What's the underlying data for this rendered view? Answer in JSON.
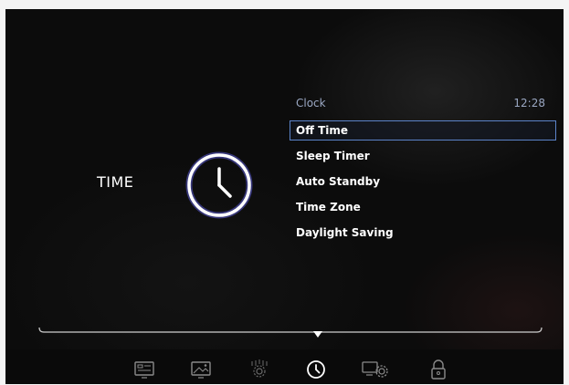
{
  "section": {
    "title": "TIME"
  },
  "menu": {
    "header_title": "Clock",
    "header_time": "12:28",
    "items": [
      {
        "label": "Off Time",
        "selected": true
      },
      {
        "label": "Sleep Timer",
        "selected": false
      },
      {
        "label": "Auto Standby",
        "selected": false
      },
      {
        "label": "Time Zone",
        "selected": false
      },
      {
        "label": "Daylight Saving",
        "selected": false
      }
    ]
  },
  "nav": {
    "active": "time-icon",
    "icons": [
      "picture-menu-icon",
      "image-icon",
      "sound-settings-icon",
      "time-icon",
      "settings-icon",
      "lock-icon"
    ]
  },
  "colors": {
    "background": "#0c0c0c",
    "accent": "#5b83c9",
    "header_text": "#9aa7c2",
    "text": "#ffffff"
  }
}
